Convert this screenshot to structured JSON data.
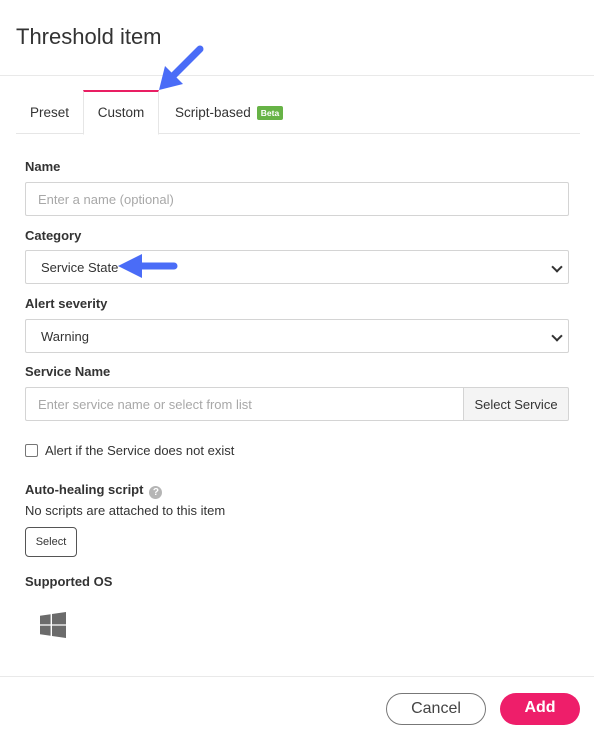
{
  "dialog": {
    "title": "Threshold item"
  },
  "tabs": [
    {
      "label": "Preset"
    },
    {
      "label": "Custom",
      "active": true
    },
    {
      "label": "Script-based",
      "badge": "Beta"
    }
  ],
  "form": {
    "name": {
      "label": "Name",
      "placeholder": "Enter a name (optional)",
      "value": ""
    },
    "category": {
      "label": "Category",
      "value": "Service State"
    },
    "severity": {
      "label": "Alert severity",
      "value": "Warning"
    },
    "service_name": {
      "label": "Service Name",
      "placeholder": "Enter service name or select from list",
      "button": "Select Service"
    },
    "alert_checkbox": {
      "label": "Alert if the Service does not exist",
      "checked": false
    },
    "auto_healing": {
      "label": "Auto-healing script",
      "help": "?",
      "status": "No scripts are attached to this item",
      "button": "Select"
    },
    "supported_os": {
      "label": "Supported OS",
      "icon": "windows-icon"
    }
  },
  "footer": {
    "cancel_label": "Cancel",
    "add_label": "Add"
  },
  "colors": {
    "accent": "#ee1e6a",
    "tab_indicator": "#e91e63",
    "beta": "#67b346",
    "annotation_arrow": "#4a6cf7"
  }
}
